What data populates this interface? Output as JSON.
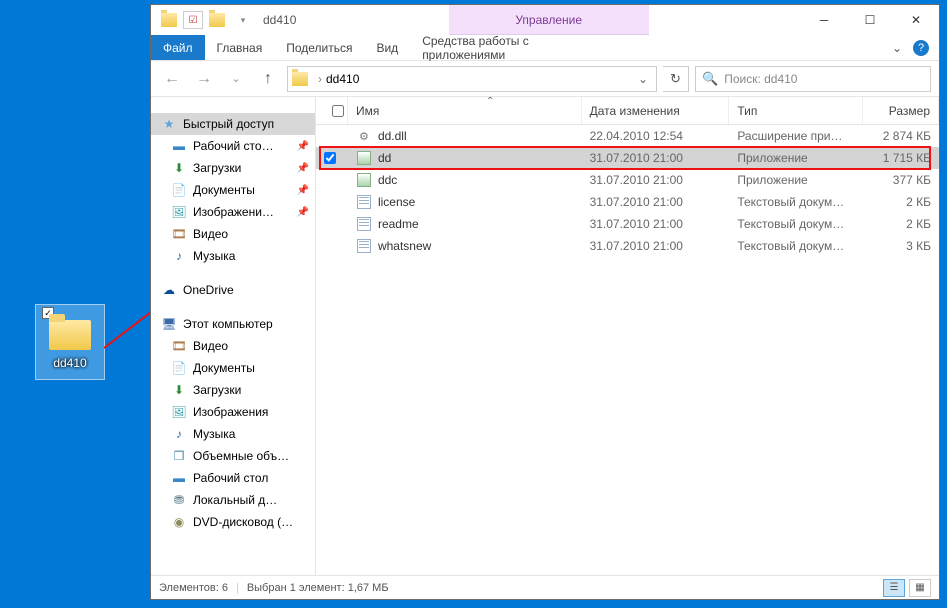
{
  "desktop": {
    "folder_label": "dd410",
    "folder_checked": true
  },
  "window": {
    "title": "dd410",
    "context_tab_group": "Управление",
    "ribbon": {
      "file": "Файл",
      "home": "Главная",
      "share": "Поделиться",
      "view": "Вид",
      "context": "Средства работы с приложениями"
    },
    "address": {
      "path_label": "dd410"
    },
    "search": {
      "placeholder": "Поиск: dd410"
    },
    "columns": {
      "name": "Имя",
      "date": "Дата изменения",
      "type": "Тип",
      "size": "Размер"
    },
    "nav": {
      "quick": "Быстрый доступ",
      "desktop": "Рабочий сто…",
      "downloads": "Загрузки",
      "documents": "Документы",
      "images": "Изображени…",
      "video": "Видео",
      "music": "Музыка",
      "onedrive": "OneDrive",
      "thispc": "Этот компьютер",
      "pc_video": "Видео",
      "pc_documents": "Документы",
      "pc_downloads": "Загрузки",
      "pc_images": "Изображения",
      "pc_music": "Музыка",
      "pc_3d": "Объемные объ…",
      "pc_desktop": "Рабочий стол",
      "pc_local": "Локальный д…",
      "pc_dvd": "DVD-дисковод (…"
    },
    "files": [
      {
        "icon": "dll",
        "name": "dd.dll",
        "date": "22.04.2010 12:54",
        "type": "Расширение при…",
        "size": "2 874 КБ",
        "selected": false
      },
      {
        "icon": "app",
        "name": "dd",
        "date": "31.07.2010 21:00",
        "type": "Приложение",
        "size": "1 715 КБ",
        "selected": true
      },
      {
        "icon": "app",
        "name": "ddc",
        "date": "31.07.2010 21:00",
        "type": "Приложение",
        "size": "377 КБ",
        "selected": false
      },
      {
        "icon": "txt",
        "name": "license",
        "date": "31.07.2010 21:00",
        "type": "Текстовый докум…",
        "size": "2 КБ",
        "selected": false
      },
      {
        "icon": "txt",
        "name": "readme",
        "date": "31.07.2010 21:00",
        "type": "Текстовый докум…",
        "size": "2 КБ",
        "selected": false
      },
      {
        "icon": "txt",
        "name": "whatsnew",
        "date": "31.07.2010 21:00",
        "type": "Текстовый докум…",
        "size": "3 КБ",
        "selected": false
      }
    ],
    "status": {
      "count": "Элементов: 6",
      "selected": "Выбран 1 элемент: 1,67 МБ"
    }
  }
}
